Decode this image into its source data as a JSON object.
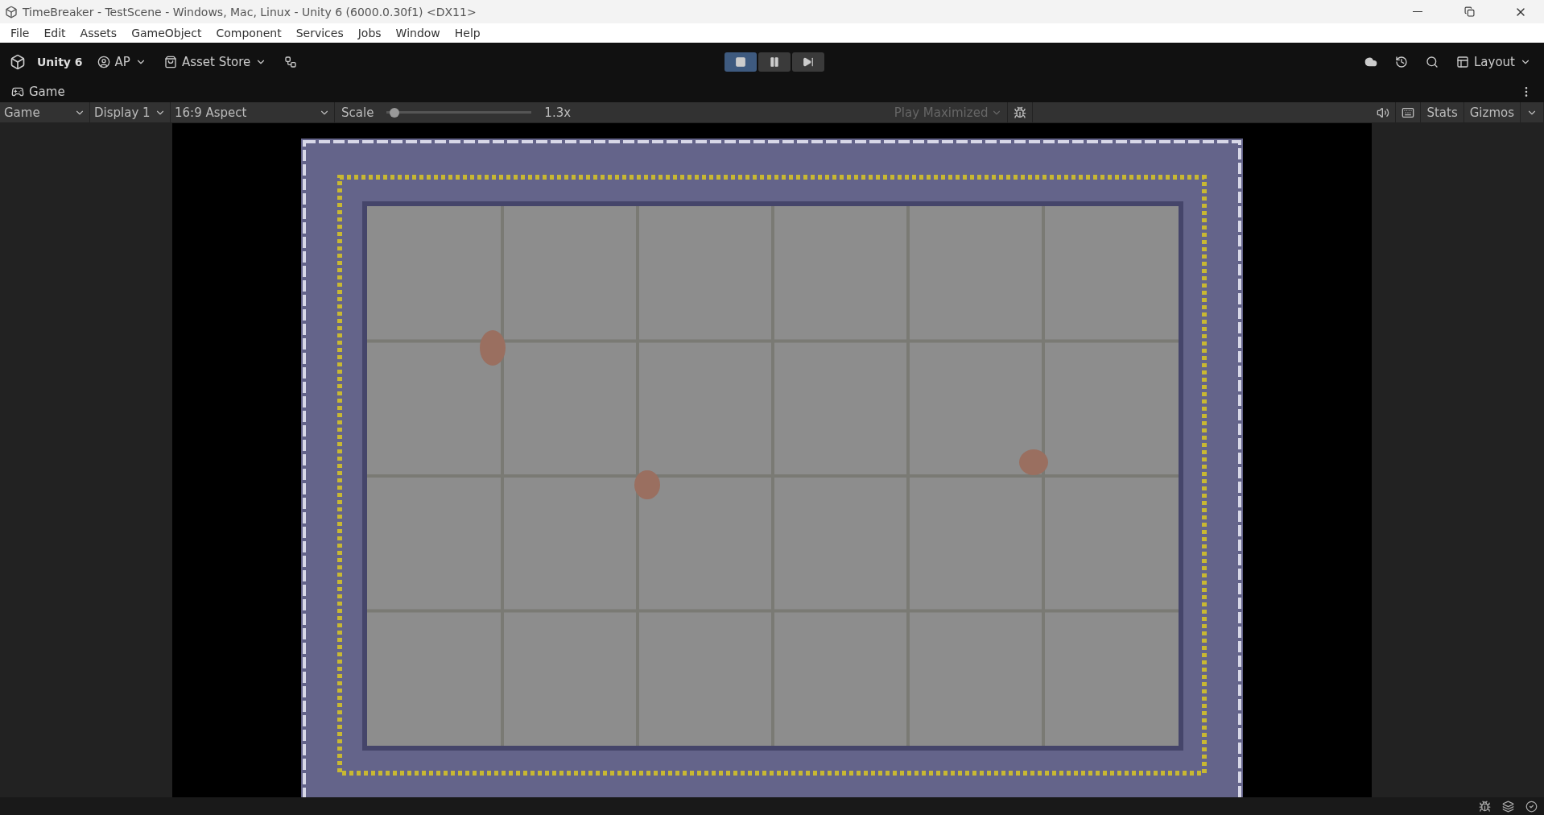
{
  "window": {
    "title": "TimeBreaker - TestScene - Windows, Mac, Linux - Unity 6 (6000.0.30f1) <DX11>"
  },
  "menu": [
    "File",
    "Edit",
    "Assets",
    "GameObject",
    "Component",
    "Services",
    "Jobs",
    "Window",
    "Help"
  ],
  "toolbar": {
    "brand": "Unity 6",
    "account": "AP",
    "store": "Asset Store",
    "layout": "Layout"
  },
  "play_controls": [
    {
      "kind": "play",
      "selected": true
    },
    {
      "kind": "pause",
      "selected": false
    },
    {
      "kind": "step",
      "selected": false
    }
  ],
  "game_tab": {
    "label": "Game"
  },
  "game_toolbar": {
    "view": "Game",
    "display": "Display 1",
    "aspect": "16:9 Aspect",
    "scale_label": "Scale",
    "scale": {
      "level": 0.02
    },
    "scale_reading": "1.3x",
    "play_mode": {
      "label": "Play Maximized",
      "disabled": true
    },
    "stats": "Stats",
    "gizmos": "Gizmos"
  }
}
